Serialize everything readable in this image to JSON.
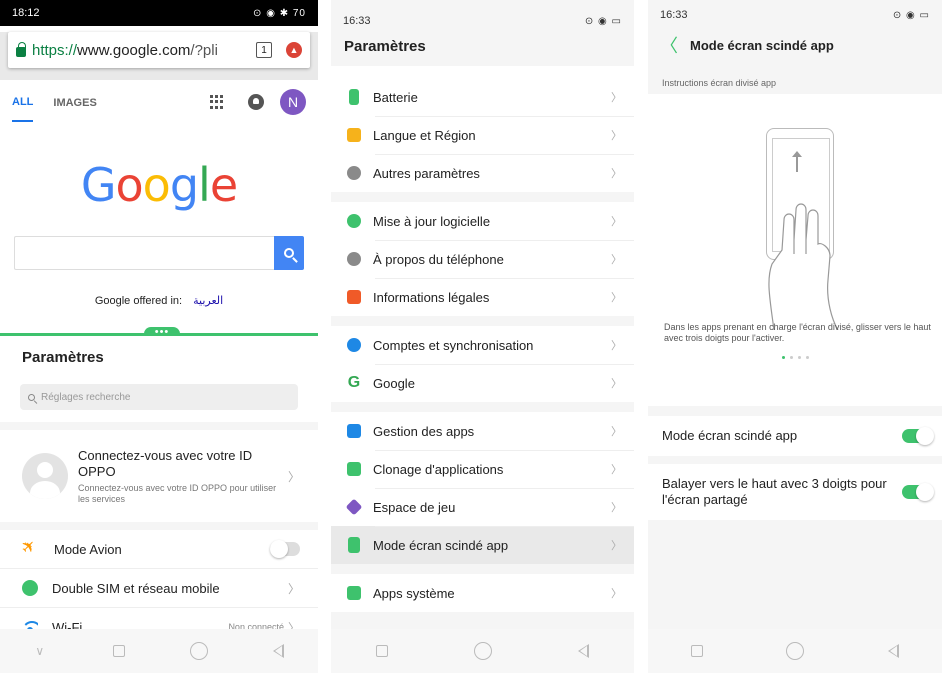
{
  "panel1": {
    "status": {
      "time": "18:12",
      "icons": "⊙ ◉ ✱ 70"
    },
    "browser": {
      "url_scheme": "https://",
      "url_host": "www.google.com",
      "url_rest": "/?pli",
      "tab_count": "1"
    },
    "google": {
      "tabs": [
        "ALL",
        "IMAGES"
      ],
      "avatar_letter": "N",
      "logo": [
        "G",
        "o",
        "o",
        "g",
        "l",
        "e"
      ],
      "search_value": "",
      "offered_in_label": "Google offered in:",
      "offered_in_lang": "العربية"
    },
    "split_handle": "•••",
    "settings": {
      "title": "Paramètres",
      "search_placeholder": "Réglages recherche",
      "account_title": "Connectez-vous avec votre ID OPPO",
      "account_sub": "Connectez-vous avec votre ID OPPO pour utiliser les services",
      "rows": [
        {
          "label": "Mode Avion",
          "extra": ""
        },
        {
          "label": "Double SIM et réseau mobile",
          "extra": ""
        },
        {
          "label": "Wi-Fi",
          "extra": "Non connecté"
        }
      ]
    }
  },
  "panel2": {
    "status": {
      "time": "16:33",
      "icons": "⊙ ◉ ▭"
    },
    "title": "Paramètres",
    "groups": [
      [
        {
          "label": "Batterie",
          "color": "#3ec26d",
          "icon": "battery-icon"
        },
        {
          "label": "Langue et Région",
          "color": "#f6b21b",
          "icon": "language-icon"
        },
        {
          "label": "Autres paramètres",
          "color": "#8a8a8a",
          "icon": "gear-icon"
        }
      ],
      [
        {
          "label": "Mise à jour logicielle",
          "color": "#3ec26d",
          "icon": "update-icon"
        },
        {
          "label": "À propos du téléphone",
          "color": "#8a8a8a",
          "icon": "info-icon"
        },
        {
          "label": "Informations légales",
          "color": "#f05a28",
          "icon": "legal-icon"
        }
      ],
      [
        {
          "label": "Comptes et synchronisation",
          "color": "#1e88e5",
          "icon": "account-icon"
        },
        {
          "label": "Google",
          "color": "#34a853",
          "icon": "google-icon"
        }
      ],
      [
        {
          "label": "Gestion des apps",
          "color": "#1e88e5",
          "icon": "apps-icon"
        },
        {
          "label": "Clonage d'applications",
          "color": "#3ec26d",
          "icon": "clone-icon"
        },
        {
          "label": "Espace de jeu",
          "color": "#7e57c2",
          "icon": "game-icon"
        },
        {
          "label": "Mode écran scindé app",
          "color": "#3ec26d",
          "icon": "split-screen-icon"
        }
      ],
      [
        {
          "label": "Apps système",
          "color": "#3ec26d",
          "icon": "system-apps-icon"
        }
      ]
    ]
  },
  "panel3": {
    "status": {
      "time": "16:33",
      "icons": "⊙ ◉ ▭"
    },
    "title": "Mode écran scindé app",
    "instructions_label": "Instructions écran divisé app",
    "demo_text": "Dans les apps prenant en charge l'écran divisé, glisser vers le haut avec trois doigts pour l'activer.",
    "toggles": [
      {
        "label": "Mode écran scindé app",
        "on": true
      },
      {
        "label": "Balayer vers le haut avec 3 doigts pour l'écran partagé",
        "on": true
      }
    ]
  },
  "colors": {
    "accent": "#3ec26d",
    "google_blue": "#4285f4"
  }
}
